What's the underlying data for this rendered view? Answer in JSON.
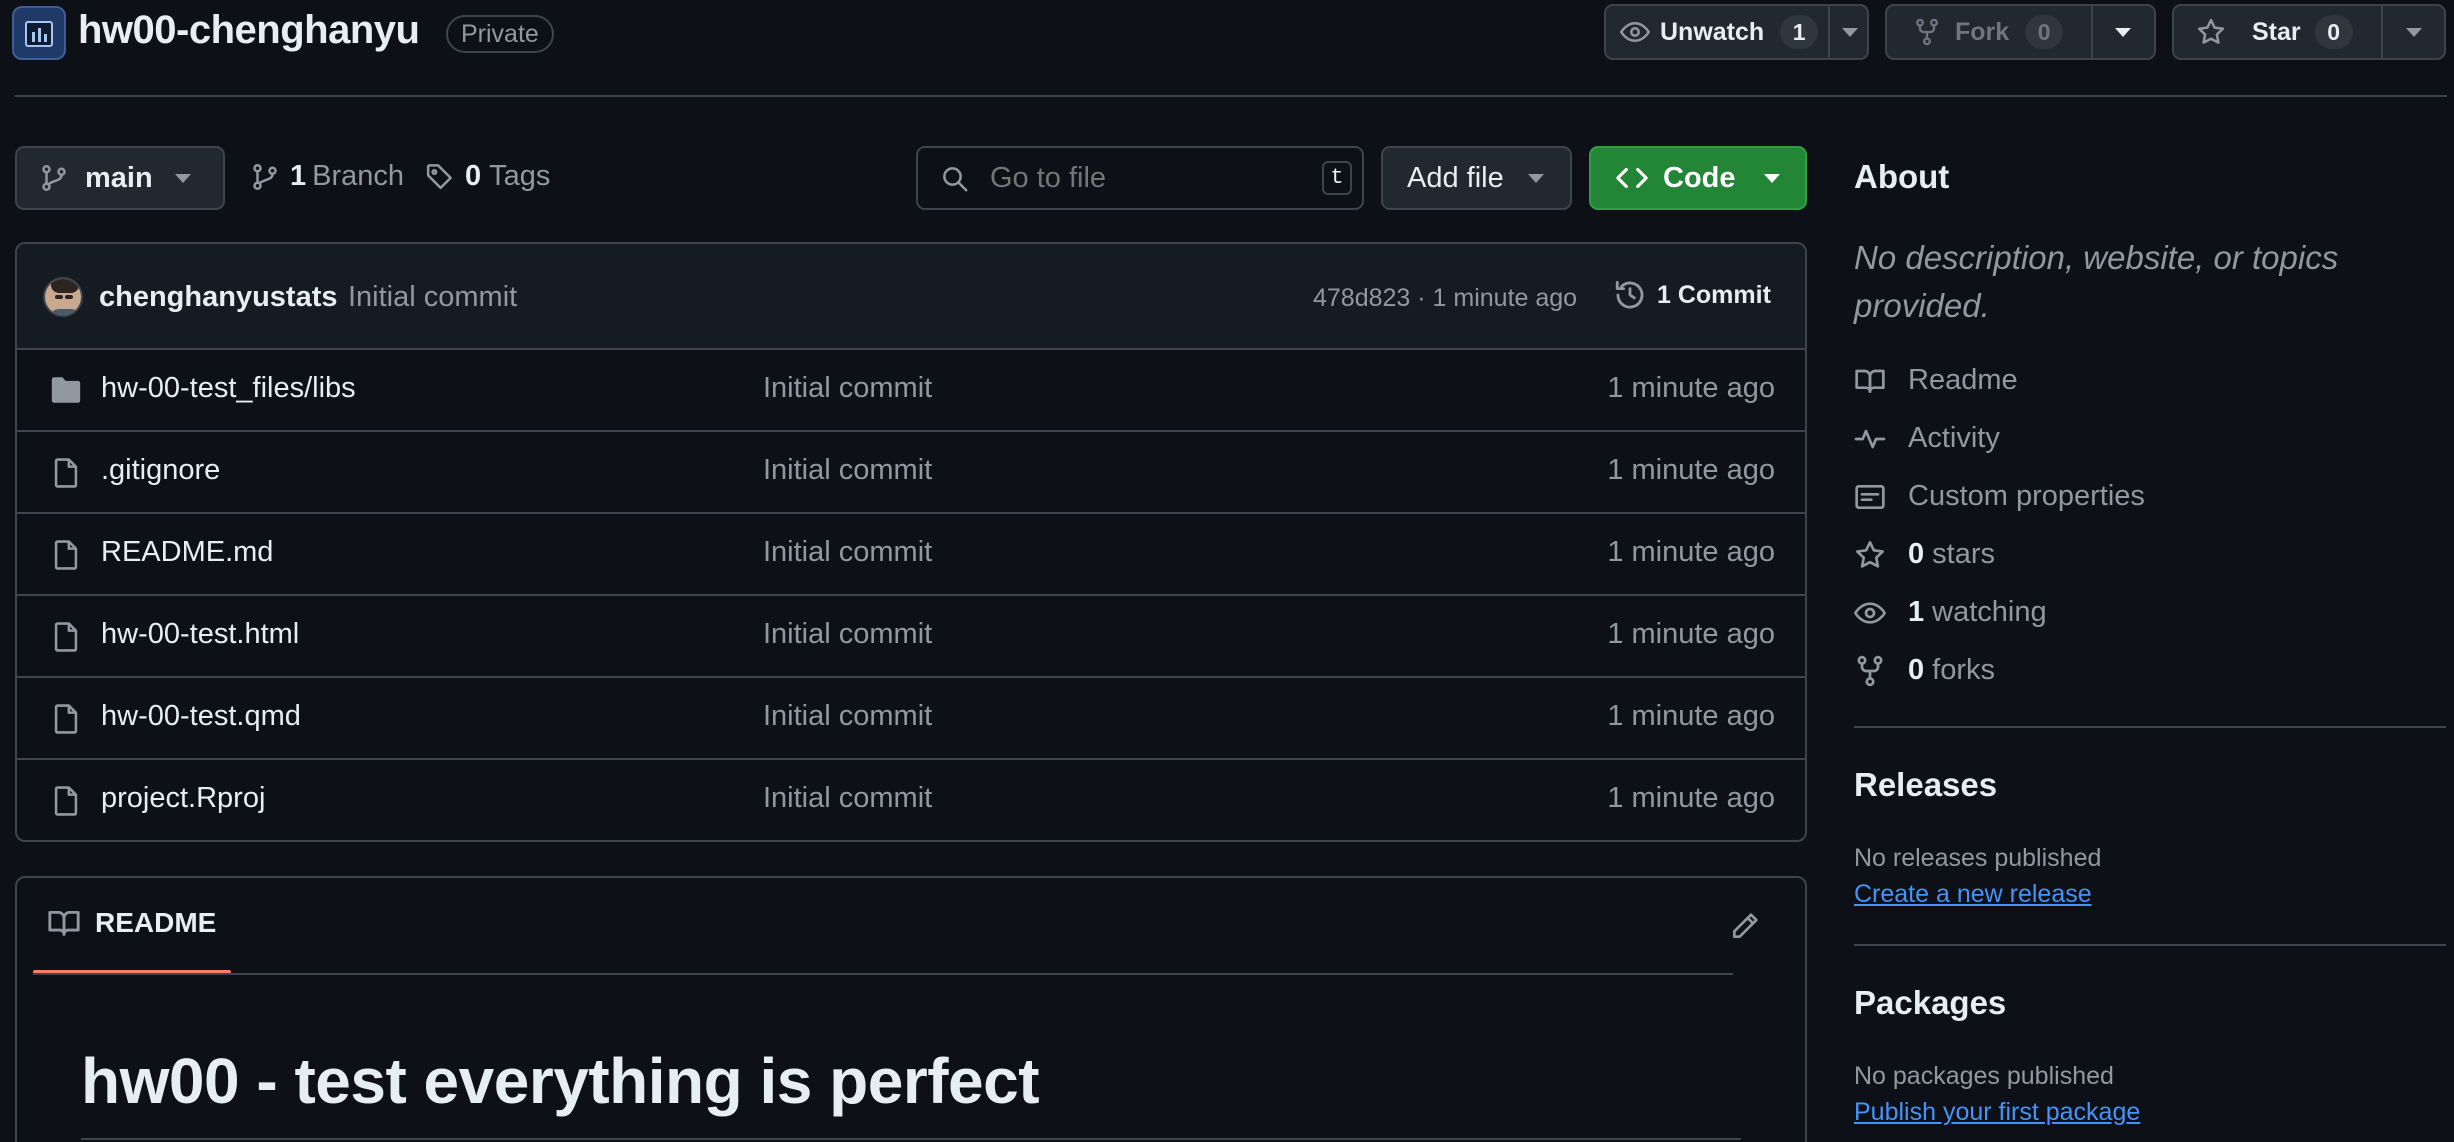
{
  "repo": {
    "name": "hw00-chenghanyu",
    "visibility": "Private"
  },
  "actions": {
    "watch": {
      "label": "Unwatch",
      "count": "1"
    },
    "fork": {
      "label": "Fork",
      "count": "0"
    },
    "star": {
      "label": "Star",
      "count": "0"
    }
  },
  "toolbar": {
    "branch": "main",
    "branch_count": "1",
    "branch_label": "Branch",
    "tag_count": "0",
    "tag_label": "Tags",
    "search_placeholder": "Go to file",
    "search_shortcut": "t",
    "add_file": "Add file",
    "code": "Code"
  },
  "latest_commit": {
    "author": "chenghanyustats",
    "message": "Initial commit",
    "meta": "478d823 · 1 minute ago",
    "commit_count_label": "1 Commit"
  },
  "files": [
    {
      "name": "hw-00-test_files/libs",
      "type": "folder",
      "message": "Initial commit",
      "time": "1 minute ago"
    },
    {
      "name": ".gitignore",
      "type": "file",
      "message": "Initial commit",
      "time": "1 minute ago"
    },
    {
      "name": "README.md",
      "type": "file",
      "message": "Initial commit",
      "time": "1 minute ago"
    },
    {
      "name": "hw-00-test.html",
      "type": "file",
      "message": "Initial commit",
      "time": "1 minute ago"
    },
    {
      "name": "hw-00-test.qmd",
      "type": "file",
      "message": "Initial commit",
      "time": "1 minute ago"
    },
    {
      "name": "project.Rproj",
      "type": "file",
      "message": "Initial commit",
      "time": "1 minute ago"
    }
  ],
  "readme": {
    "tab_label": "README",
    "heading": "hw00 - test everything is perfect"
  },
  "about": {
    "title": "About",
    "description": "No description, website, or topics provided.",
    "readme": "Readme",
    "activity": "Activity",
    "custom_properties": "Custom properties",
    "stars_count": "0",
    "stars_label": "stars",
    "watching_count": "1",
    "watching_label": "watching",
    "forks_count": "0",
    "forks_label": "forks"
  },
  "releases": {
    "title": "Releases",
    "empty": "No releases published",
    "link": "Create a new release"
  },
  "packages": {
    "title": "Packages",
    "empty": "No packages published",
    "link": "Publish your first package"
  },
  "colors": {
    "background": "#0d1117",
    "border": "#3d444d",
    "accent_green": "#238636",
    "link": "#4493f8",
    "tab_underline": "#f78166",
    "muted": "#9198a1"
  }
}
